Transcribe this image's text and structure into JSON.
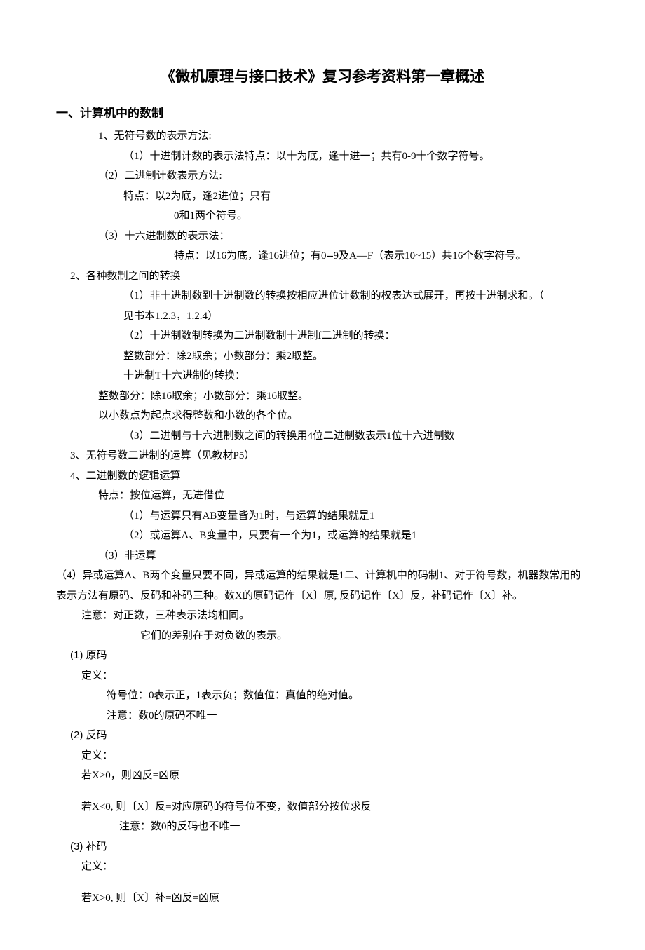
{
  "title": "《微机原理与接口技术》复习参考资料第一章概述",
  "section1_heading": "一、计算机中的数制",
  "s1_1": "1、无符号数的表示方法:",
  "s1_1_1": "（1）十进制计数的表示法特点：以十为底，逢十进一；共有0-9十个数字符号。",
  "s1_1_2": "（2）二进制计数表示方法:",
  "s1_1_2a": "特点：以2为底，逢2进位；只有",
  "s1_1_2b": "0和1两个符号。",
  "s1_1_3": "（3）十六进制数的表示法：",
  "s1_1_3a": "特点：以16为底，逢16进位；有0--9及A—F（表示10~15）共16个数字符号。",
  "s1_2": "2、各种数制之间的转换",
  "s1_2_1a": "（1）非十进制数到十进制数的转换按相应进位计数制的权表达式展开，再按十进制求和。（",
  "s1_2_1b": "见书本1.2.3，1.2.4）",
  "s1_2_2": "（2）十进制数制转换为二进制数制十进制f二进制的转换：",
  "s1_2_2a": "整数部分：除2取余；小数部分：乘2取整。",
  "s1_2_2b": "十进制T十六进制的转换：",
  "s1_2_2c": "整数部分：除16取余；小数部分：乘16取整。",
  "s1_2_2d": "以小数点为起点求得整数和小数的各个位。",
  "s1_2_3": "（3）二进制与十六进制数之间的转换用4位二进制数表示1位十六进制数",
  "s1_3": "3、无符号数二进制的运算（见教材P5）",
  "s1_4": "4、二进制数的逻辑运算",
  "s1_4a": "特点：按位运算，无进借位",
  "s1_4b": "（1）与运算只有AB变量皆为1时，与运算的结果就是1",
  "s1_4c": "（2）或运算A、B变量中，只要有一个为1，或运算的结果就是1",
  "s1_4d": "（3）非运算",
  "s1_4e": "（4）异或运算A、B两个变量只要不同，异或运算的结果就是1二、计算机中的码制1、对于符号数，机器数常用的表示方法有原码、反码和补码三种。数X的原码记作〔X〕原, 反码记作〔X〕反，补码记作〔X〕补。",
  "note1": "注意：对正数，三种表示法均相同。",
  "note1a": "它们的差别在于对负数的表示。",
  "p1_h": "(1)   原码",
  "p1_def": "定义：",
  "p1_a": "符号位：0表示正，1表示负；数值位：真值的绝对值。",
  "p1_b": "注意：数0的原码不唯一",
  "p2_h": "(2)   反码",
  "p2_def": "定义：",
  "p2_a": "若X>0，则凶反=凶原",
  "p2_b": "若X<0, 则〔X〕反=对应原码的符号位不变，数值部分按位求反",
  "p2_c": "注意：数0的反码也不唯一",
  "p3_h": "(3)  补码",
  "p3_def": "定义：",
  "p3_a": "若X>0, 则〔X〕补=凶反=凶原"
}
